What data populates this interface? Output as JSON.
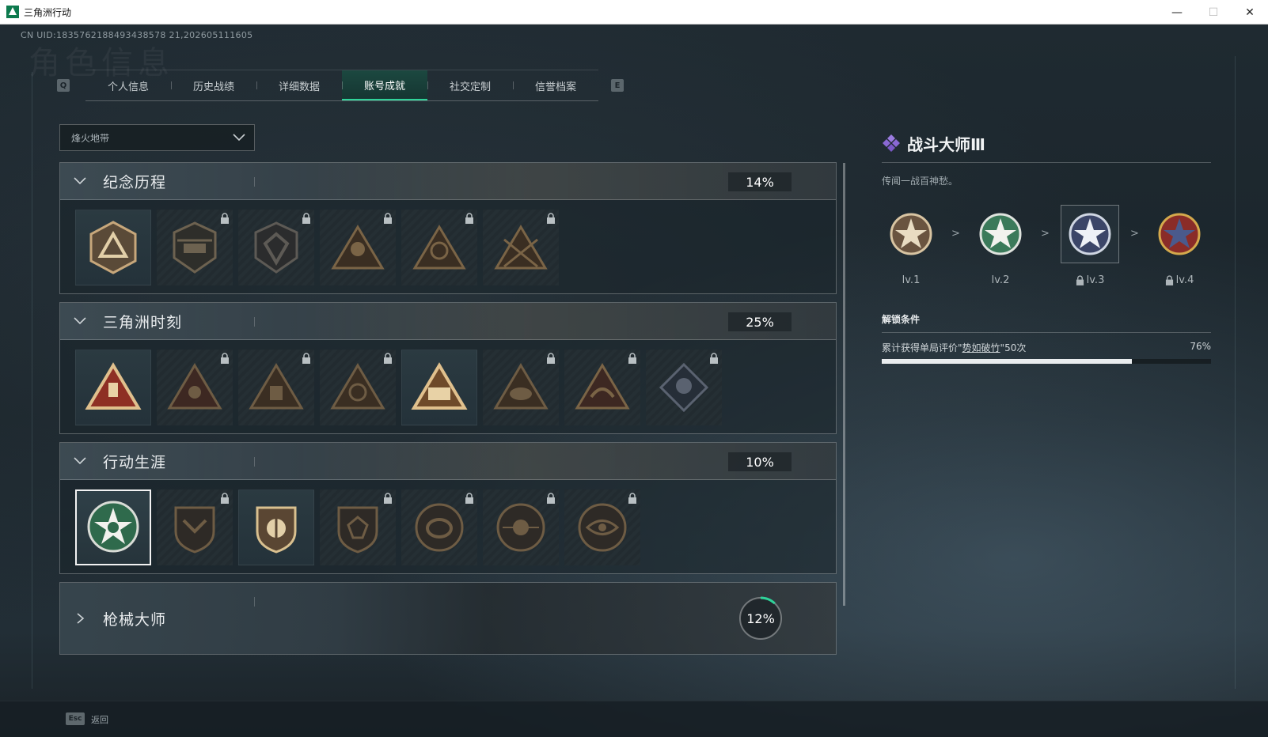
{
  "window": {
    "title": "三角洲行动",
    "minimize": "—",
    "maximize": "☐",
    "close": "✕"
  },
  "uid_text": "CN UID:1835762188493438578 21,202605111605",
  "header_ghost_title": "角色信息",
  "tabs": {
    "left_key": "Q",
    "right_key": "E",
    "items": [
      {
        "label": "个人信息"
      },
      {
        "label": "历史战绩"
      },
      {
        "label": "详细数据"
      },
      {
        "label": "账号成就",
        "active": true
      },
      {
        "label": "社交定制"
      },
      {
        "label": "信誉档案"
      }
    ]
  },
  "mode_dropdown": {
    "value": "烽火地带"
  },
  "sections": [
    {
      "title": "纪念历程",
      "percent": "14%",
      "expanded": true,
      "badges": [
        {
          "icon": "triangle-emblem-icon",
          "locked": false
        },
        {
          "icon": "helicopter-shield-icon",
          "locked": true
        },
        {
          "icon": "shield-crest-icon",
          "locked": true
        },
        {
          "icon": "soldier-triangle-icon",
          "locked": true
        },
        {
          "icon": "operator-portrait-icon",
          "locked": true
        },
        {
          "icon": "crossed-blades-icon",
          "locked": true
        }
      ]
    },
    {
      "title": "三角洲时刻",
      "percent": "25%",
      "expanded": true,
      "badges": [
        {
          "icon": "red-triangle-usb-icon",
          "locked": false
        },
        {
          "icon": "red-triangle-figure-icon",
          "locked": true
        },
        {
          "icon": "triangle-sitting-figure-icon",
          "locked": true
        },
        {
          "icon": "triangle-hands-icon",
          "locked": true
        },
        {
          "icon": "triangle-squad-icon",
          "locked": false
        },
        {
          "icon": "triangle-beast-icon",
          "locked": true
        },
        {
          "icon": "triangle-dragon-icon",
          "locked": true
        },
        {
          "icon": "diamond-rose-icon",
          "locked": true
        }
      ]
    },
    {
      "title": "行动生涯",
      "percent": "10%",
      "expanded": true,
      "badges": [
        {
          "icon": "green-star-medal-icon",
          "locked": false,
          "selected": true
        },
        {
          "icon": "shield-wings-icon",
          "locked": true
        },
        {
          "icon": "shield-split-icon",
          "locked": false
        },
        {
          "icon": "shield-gem-icon",
          "locked": true
        },
        {
          "icon": "round-helmet-icon",
          "locked": true
        },
        {
          "icon": "round-target-icon",
          "locked": true
        },
        {
          "icon": "round-eye-icon",
          "locked": true
        }
      ]
    },
    {
      "title": "枪械大师",
      "percent": "12%",
      "progress_fraction": 0.12,
      "expanded": false
    }
  ],
  "detail": {
    "title": "战斗大师Ⅲ",
    "description": "传闻一战百神愁。",
    "levels": [
      {
        "label": "lv.1",
        "locked": false,
        "color": "#b89a78"
      },
      {
        "label": "lv.2",
        "locked": false,
        "color": "#3b7a5a"
      },
      {
        "label": "lv.3",
        "locked": true,
        "current": true,
        "color": "#3c4668"
      },
      {
        "label": "lv.4",
        "locked": true,
        "color": "#8a2c28"
      }
    ],
    "arrow": ">",
    "unlock_title": "解锁条件",
    "condition_prefix": "累计获得单局评价\"",
    "condition_highlight": "势如破竹",
    "condition_suffix": "\"50次",
    "condition_percent": "76%",
    "condition_progress": 0.76
  },
  "footer": {
    "esc_key": "Esc",
    "back_label": "返回"
  },
  "colors": {
    "accent": "#2fd39a",
    "tab_active_bg": "#1b4b41",
    "purple_diamond": "#8f6bd6"
  }
}
